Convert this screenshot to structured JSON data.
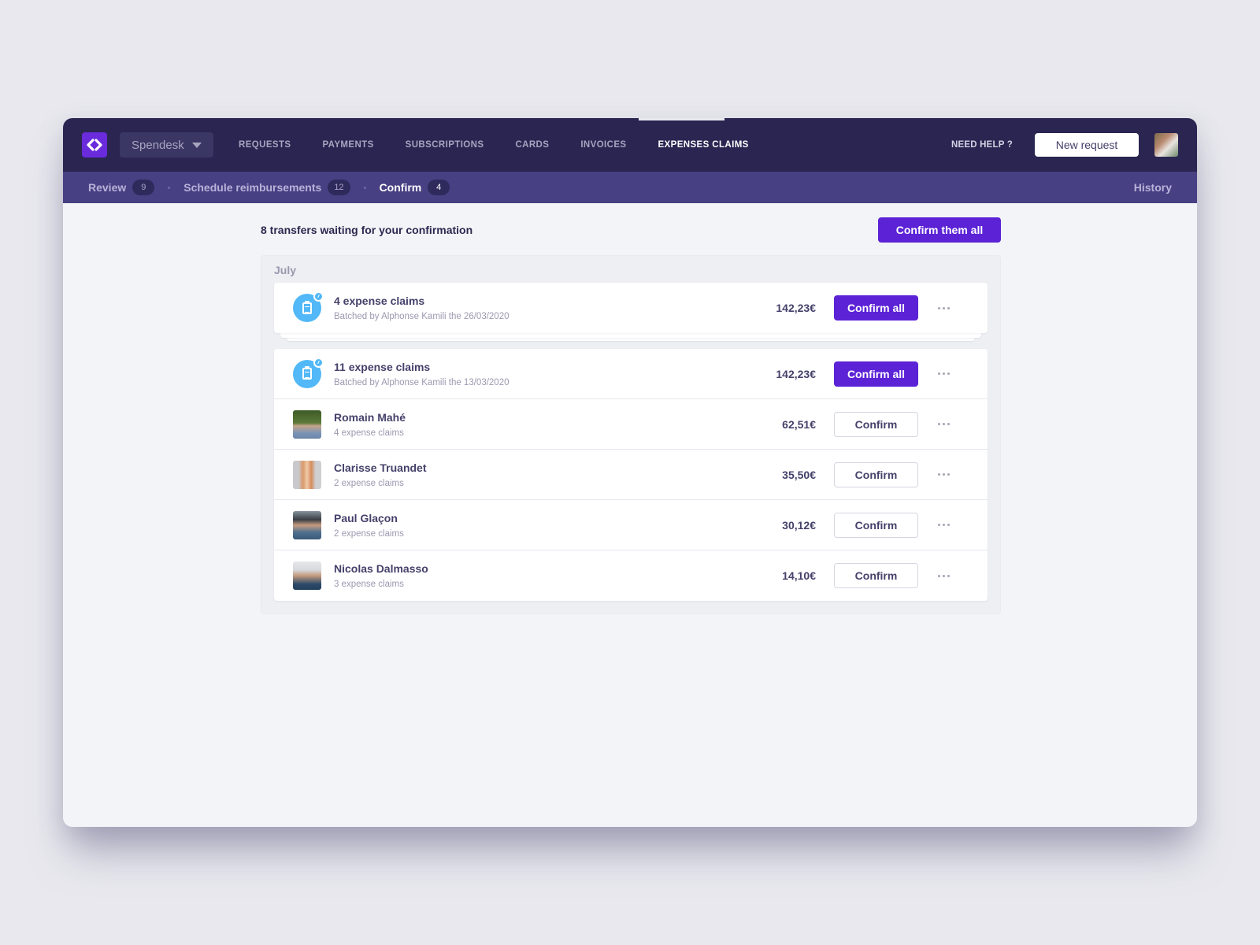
{
  "app": {
    "logo_icon": "spendesk-logo-icon",
    "company": "Spendesk",
    "nav": [
      {
        "label": "REQUESTS",
        "active": false
      },
      {
        "label": "PAYMENTS",
        "active": false
      },
      {
        "label": "SUBSCRIPTIONS",
        "active": false
      },
      {
        "label": "CARDS",
        "active": false
      },
      {
        "label": "INVOICES",
        "active": false
      },
      {
        "label": "EXPENSES CLAIMS",
        "active": true
      }
    ],
    "help": "NEED HELP ?",
    "new_request": "New request"
  },
  "subnav": {
    "items": [
      {
        "label": "Review",
        "count": "9",
        "active": false
      },
      {
        "label": "Schedule reimbursements",
        "count": "12",
        "active": false
      },
      {
        "label": "Confirm",
        "count": "4",
        "active": true
      }
    ],
    "history": "History"
  },
  "main": {
    "title": "8 transfers waiting for your confirmation",
    "confirm_all_button": "Confirm them all",
    "group_label": "July",
    "batches": [
      {
        "title": "4 expense claims",
        "subtitle": "Batched by Alphonse Kamili the 26/03/2020",
        "amount": "142,23€",
        "button": "Confirm all"
      },
      {
        "title": "11 expense claims",
        "subtitle": "Batched by Alphonse Kamili the 13/03/2020",
        "amount": "142,23€",
        "button": "Confirm all"
      }
    ],
    "people": [
      {
        "name": "Romain Mahé",
        "subtitle": "4 expense claims",
        "amount": "62,51€",
        "button": "Confirm"
      },
      {
        "name": "Clarisse Truandet",
        "subtitle": "2 expense claims",
        "amount": "35,50€",
        "button": "Confirm"
      },
      {
        "name": "Paul Glaçon",
        "subtitle": "2 expense claims",
        "amount": "30,12€",
        "button": "Confirm"
      },
      {
        "name": "Nicolas Dalmasso",
        "subtitle": "3 expense claims",
        "amount": "14,10€",
        "button": "Confirm"
      }
    ]
  },
  "colors": {
    "topbar": "#2a2551",
    "subbar": "#474083",
    "primary": "#5c22d6",
    "batch_icon": "#52b8f7"
  }
}
